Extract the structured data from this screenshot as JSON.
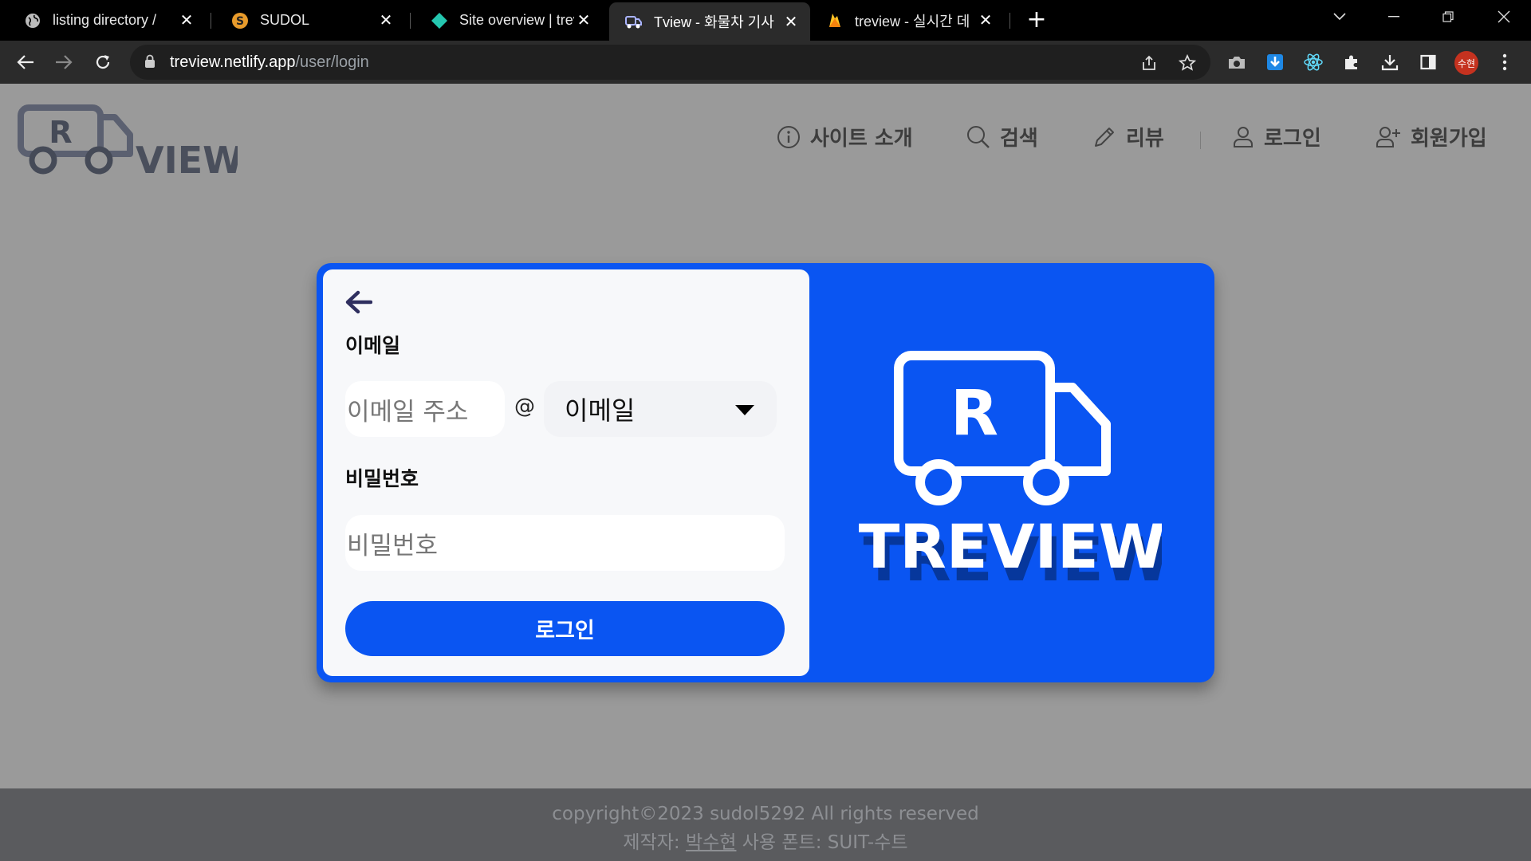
{
  "browser": {
    "tabs": [
      {
        "title": "listing directory /",
        "icon": "globe-icon"
      },
      {
        "title": "SUDOL",
        "icon": "sudol-s-icon"
      },
      {
        "title": "Site overview | trev",
        "icon": "netlify-diamond-icon"
      },
      {
        "title": "Tview - 화물차 기사",
        "icon": "treview-truck-icon",
        "active": true
      },
      {
        "title": "treview - 실시간 데",
        "icon": "firebase-flame-icon"
      }
    ],
    "close_glyph": "✕",
    "new_tab_glyph": "+",
    "url_host": "treview.netlify.app",
    "url_path": "/user/login",
    "profile_initials": "수현",
    "colors": {
      "tab_bar": "#000000",
      "toolbar": "#2b2b2b",
      "profile": "#c5321f"
    }
  },
  "site": {
    "logo_text": "VIEW",
    "logo_letter": "R",
    "nav": [
      {
        "label": "사이트 소개",
        "icon": "info-icon"
      },
      {
        "label": "검색",
        "icon": "search-icon"
      },
      {
        "label": "리뷰",
        "icon": "pencil-icon"
      },
      {
        "label": "로그인",
        "icon": "user-icon"
      },
      {
        "label": "회원가입",
        "icon": "user-plus-icon"
      }
    ],
    "colors": {
      "primary": "#0a55f2",
      "page_bg": "#9a9a9a"
    }
  },
  "login": {
    "email_label": "이메일",
    "email_placeholder": "이메일 주소",
    "at_symbol": "@",
    "domain_select_value": "이메일",
    "password_label": "비밀번호",
    "password_placeholder": "비밀번호",
    "submit_label": "로그인",
    "brand_text": "TREVIEW",
    "brand_letter": "R"
  },
  "footer": {
    "copyright": "copyright©2023 sudol5292 All rights reserved",
    "maker_prefix": "제작자: ",
    "maker_name": "박수현",
    "font_credit": " 사용 폰트: SUIT-수트"
  }
}
